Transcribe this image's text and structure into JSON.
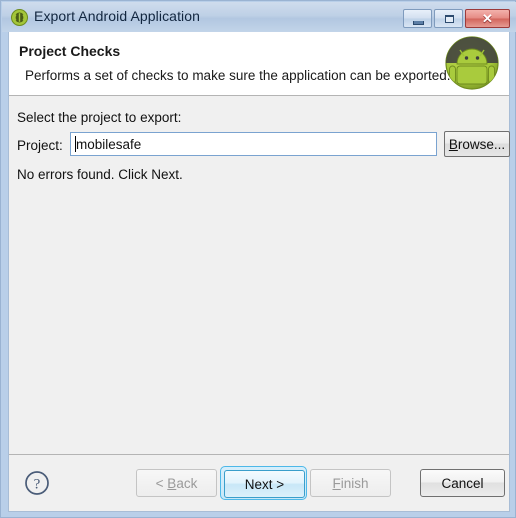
{
  "window": {
    "title": "Export Android Application",
    "title_icon": "android-circle-icon",
    "controls": {
      "minimize_label": "Minimize",
      "maximize_label": "Maximize",
      "close_label": "Close",
      "close_glyph": "✕"
    }
  },
  "header": {
    "title": "Project Checks",
    "description": "Performs a set of checks to make sure the application can be exported.",
    "image_name": "android-robot-badge"
  },
  "main": {
    "instruction": "Select the project to export:",
    "project_label": "Project:",
    "project_value": "mobilesafe",
    "project_placeholder": "",
    "browse_label": "Browse...",
    "browse_mnemonic": "B",
    "browse_rest": "rowse...",
    "status_message": "No errors found. Click Next."
  },
  "footer": {
    "help_icon": "help-question-icon",
    "buttons": [
      {
        "name": "back",
        "label": "< Back",
        "mnemonic": "B",
        "prefix": "< ",
        "suffix": "ack",
        "enabled": false,
        "default": false
      },
      {
        "name": "next",
        "label": "Next >",
        "mnemonic": "",
        "prefix": "Next >",
        "suffix": "",
        "enabled": true,
        "default": true
      },
      {
        "name": "finish",
        "label": "Finish",
        "mnemonic": "F",
        "prefix": "",
        "suffix": "inish",
        "enabled": false,
        "default": false
      },
      {
        "name": "cancel",
        "label": "Cancel",
        "mnemonic": "",
        "prefix": "Cancel",
        "suffix": "",
        "enabled": true,
        "default": false
      }
    ]
  },
  "colors": {
    "title_bar": "#bed0e6",
    "frame": "#b9cfe9",
    "body": "#f0f0f0",
    "header_band": "#ffffff",
    "accent_default_button": "#4db8e8",
    "close_button": "#d2655c",
    "android_green": "#a4c639"
  }
}
